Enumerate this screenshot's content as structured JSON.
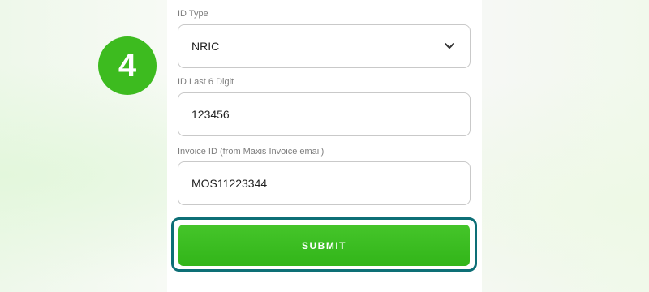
{
  "step": {
    "number": "4"
  },
  "form": {
    "id_type": {
      "label": "ID Type",
      "value": "NRIC"
    },
    "id_last6": {
      "label": "ID Last 6 Digit",
      "value": "123456"
    },
    "invoice_id": {
      "label": "Invoice ID (from Maxis Invoice email)",
      "value": "MOS11223344"
    },
    "submit_label": "SUBMIT"
  },
  "colors": {
    "accent_green": "#3dbb1f",
    "highlight_border": "#0d6f76"
  }
}
